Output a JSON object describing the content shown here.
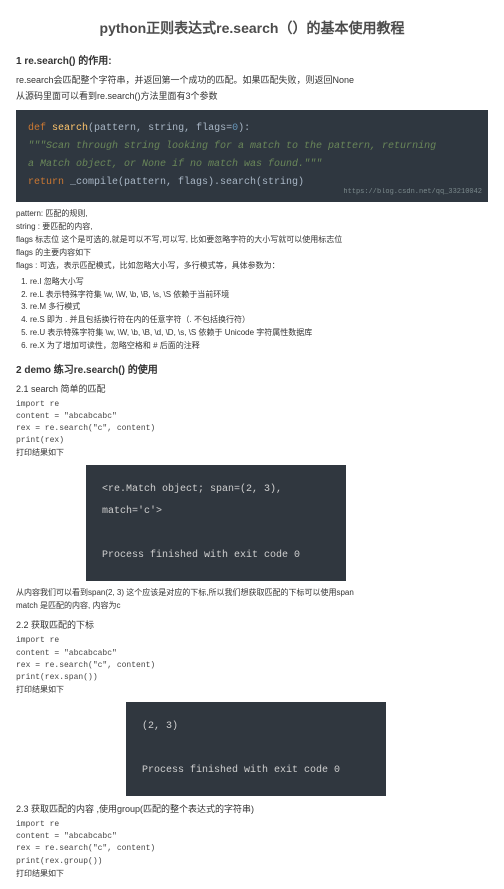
{
  "title": "python正则表达式re.search（）的基本使用教程",
  "section1_heading": "1 re.search() 的作用:",
  "section1_p1": "re.search会匹配整个字符串，并返回第一个成功的匹配。如果匹配失败，则返回None",
  "section1_p2": "从源码里面可以看到re.search()方法里面有3个参数",
  "codesig": {
    "def": "def ",
    "fn": "search",
    "open": "(pattern",
    "c1": ", ",
    "arg2": "string",
    "c2": ", ",
    "arg3": "flags",
    "eq": "=",
    "zero": "0",
    "close": "):",
    "doc1": "    \"\"\"Scan through string looking for a match to the pattern, returning",
    "doc2": "    a Match object, or None if no match was found.\"\"\"",
    "ret": "    return ",
    "comp": "_compile",
    "retargs": "(pattern, flags).search(string)",
    "watermark": "https://blog.csdn.net/qq_33210042"
  },
  "params_p1": "pattern: 匹配的规则,",
  "params_p2": "string : 要匹配的内容,",
  "params_p3": "flags 标志位 这个是可选的,就是可以不写,可以写, 比如要忽略字符的大小写就可以使用标志位",
  "params_p4": "flags 的主要内容如下",
  "params_p5": "flags : 可选，表示匹配模式，比如忽略大小写，多行模式等，具体参数为：",
  "flags_list": [
    "re.I 忽略大小写",
    "re.L 表示特殊字符集 \\w, \\W, \\b, \\B, \\s, \\S 依赖于当前环境",
    "re.M 多行模式",
    "re.S 即为 . 并且包括换行符在内的任意字符（. 不包括换行符）",
    "re.U 表示特殊字符集 \\w, \\W, \\b, \\B, \\d, \\D, \\s, \\S 依赖于 Unicode 字符属性数据库",
    "re.X 为了增加可读性，忽略空格和 # 后面的注释"
  ],
  "section2_heading": "2 demo 练习re.search() 的使用",
  "sub21": "2.1  search 简单的匹配",
  "code21": [
    "import re",
    "",
    "content = \"abcabcabc\"",
    "rex = re.search(\"c\", content)",
    "print(rex)"
  ],
  "print_label1": "打印结果如下",
  "term1_l1": "<re.Match object; span=(2, 3), match='c'>",
  "term1_l2": "Process finished with exit code 0",
  "after_term1": "从内容我们可以看到span(2, 3) 这个应该是对应的下标,所以我们想获取匹配的下标可以使用span",
  "match_note": "match 是匹配的内容, 内容为c",
  "sub22": "2.2 获取匹配的下标",
  "code22": [
    "import re",
    "",
    "content = \"abcabcabc\"",
    "rex = re.search(\"c\", content)",
    "print(rex.span())"
  ],
  "print_label2": "打印结果如下",
  "term2_l1": "(2, 3)",
  "term2_l2": "Process finished with exit code 0",
  "sub23": "2.3 获取匹配的内容 ,使用group(匹配的整个表达式的字符串)",
  "code23": [
    "import re",
    "",
    "content = \"abcabcabc\"",
    "rex = re.search(\"c\", content)",
    "print(rex.group())"
  ],
  "print_label3": "打印结果如下"
}
